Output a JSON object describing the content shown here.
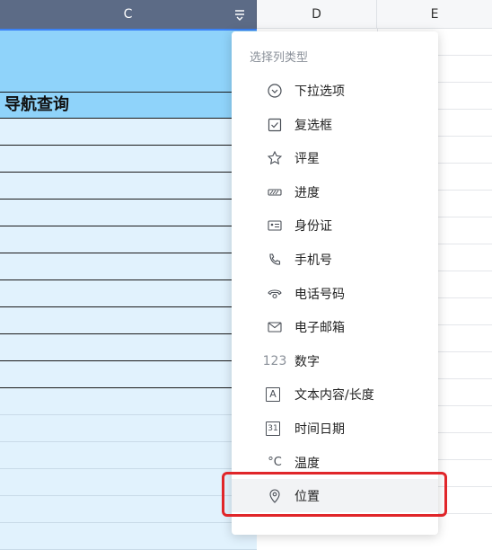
{
  "columns": {
    "c": "C",
    "d": "D",
    "e": "E"
  },
  "sheet": {
    "title_cell": "导航查询"
  },
  "menu": {
    "header": "选择列类型",
    "items": [
      {
        "label": "下拉选项",
        "icon": "dropdown-circle-icon"
      },
      {
        "label": "复选框",
        "icon": "checkbox-icon"
      },
      {
        "label": "评星",
        "icon": "star-icon"
      },
      {
        "label": "进度",
        "icon": "progress-icon"
      },
      {
        "label": "身份证",
        "icon": "id-card-icon"
      },
      {
        "label": "手机号",
        "icon": "phone-icon"
      },
      {
        "label": "电话号码",
        "icon": "telephone-icon"
      },
      {
        "label": "电子邮箱",
        "icon": "mail-icon"
      },
      {
        "label": "数字",
        "icon": "number-icon",
        "glyph": "123"
      },
      {
        "label": "文本内容/长度",
        "icon": "text-icon",
        "glyph": "A"
      },
      {
        "label": "时间日期",
        "icon": "calendar-icon",
        "glyph": "31"
      },
      {
        "label": "温度",
        "icon": "temperature-icon",
        "glyph": "°C"
      },
      {
        "label": "位置",
        "icon": "location-icon",
        "selected": true
      }
    ]
  },
  "colors": {
    "header_active": "#5c6b86",
    "cell_blue": "#8fd3fa",
    "cell_light": "#e1f2fd",
    "highlight": "#e0262a"
  }
}
